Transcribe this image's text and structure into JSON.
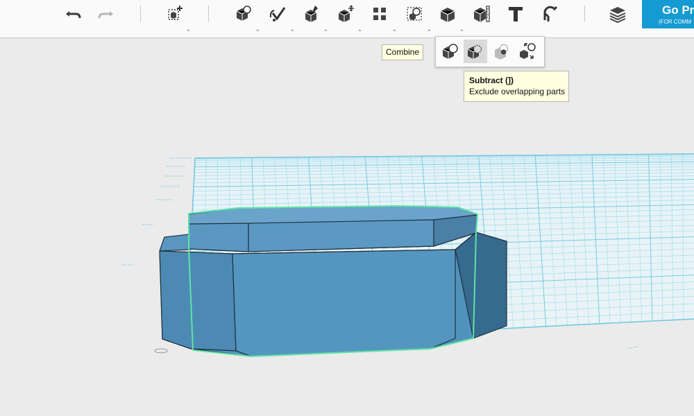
{
  "toolbar": {
    "undo_icon": "undo-arrow-icon",
    "redo_icon": "redo-arrow-icon",
    "tools": [
      "add-shape-icon",
      "transform-icon",
      "sketch-icon",
      "construct-icon",
      "modify-icon",
      "pattern-icon",
      "group-icon",
      "combine-icon",
      "measure-icon",
      "text-icon",
      "snap-icon",
      "material-icon"
    ]
  },
  "go_pro": {
    "title": "Go Pr",
    "subtitle": "(FOR COMM"
  },
  "combine_tooltip": {
    "label": "Combine"
  },
  "combine_popup": {
    "items": [
      "merge-icon",
      "subtract-icon",
      "intersect-icon",
      "separate-icon"
    ],
    "highlighted": "subtract-icon"
  },
  "subtract_tooltip": {
    "title": "Subtract (])",
    "description": "Exclude overlapping parts"
  },
  "colors": {
    "background": "#ebebeb",
    "toolbar": "#fafafa",
    "accent": "#159ad1",
    "grid": "#6cc7de",
    "solid_front": "#5192bc",
    "solid_side": "#366a8e",
    "solid_top": "#6aa4cb",
    "selection": "#5ee3a3",
    "tooltip_bg": "#ffffe1"
  }
}
